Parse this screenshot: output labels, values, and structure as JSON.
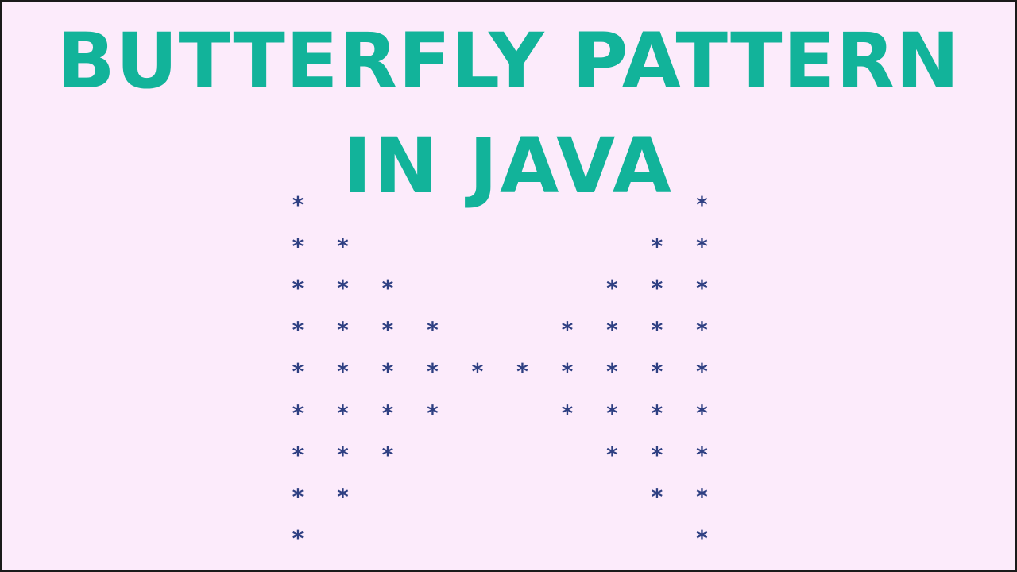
{
  "title": {
    "line1": "BUTTERFLY PATTERN",
    "line2": "IN JAVA"
  },
  "pattern": {
    "glyph": "*",
    "rows": [
      1,
      2,
      3,
      4,
      5,
      4,
      3,
      2,
      1
    ]
  },
  "colors": {
    "background": "#fcebfb",
    "title": "#12b39a",
    "star": "#2e3f82",
    "border": "#1a1a1a"
  }
}
